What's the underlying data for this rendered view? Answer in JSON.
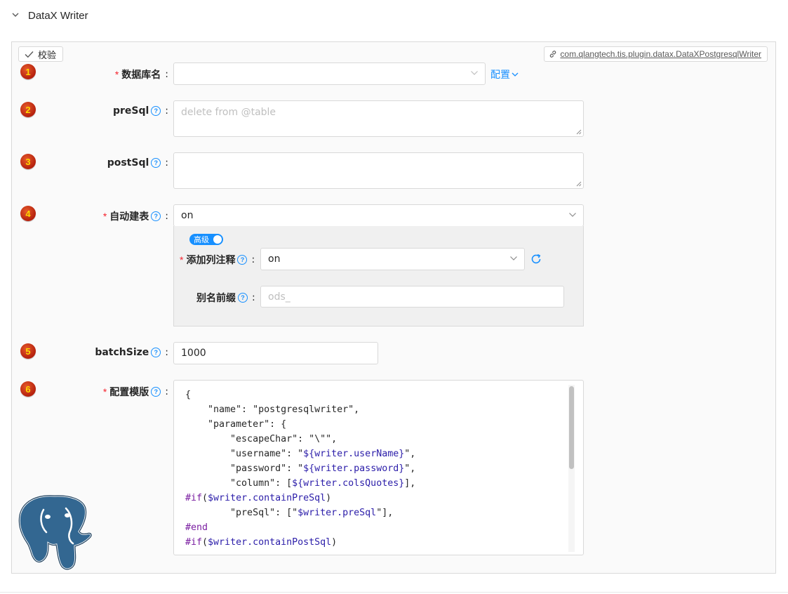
{
  "panel": {
    "title": "DataX Writer"
  },
  "toolbar": {
    "check_label": "校验",
    "plugin_name": "com.qlangtech.tis.plugin.datax.DataXPostgresqlWriter"
  },
  "fields": [
    {
      "index": "1",
      "label": "数据库名",
      "required": true,
      "value": "",
      "link_label": "配置"
    },
    {
      "index": "2",
      "label": "preSql",
      "placeholder": "delete from @table"
    },
    {
      "index": "3",
      "label": "postSql",
      "placeholder": ""
    },
    {
      "index": "4",
      "label": "自动建表",
      "required": true,
      "value": "on"
    },
    {
      "index": "5",
      "label": "batchSize",
      "value": "1000"
    },
    {
      "index": "6",
      "label": "配置模版",
      "required": true
    }
  ],
  "advanced": {
    "toggle_label": "高级",
    "add_comment": {
      "label": "添加列注释",
      "value": "on"
    },
    "alias_prefix": {
      "label": "别名前缀",
      "placeholder": "ods_"
    }
  },
  "colon": ":",
  "required_mark": "*",
  "help_glyph": "?",
  "template_lines": [
    "{",
    "    \"name\": \"postgresqlwriter\",",
    "    \"parameter\": {",
    "        \"escapeChar\": \"\\\"\",",
    "        \"username\": \"${writer.userName}\",",
    "        \"password\": \"${writer.password}\",",
    "        \"column\": [${writer.colsQuotes}],",
    "#if($writer.containPreSql)",
    "        \"preSql\": [\"$writer.preSql\"],",
    "#end",
    "#if($writer.containPostSql)"
  ],
  "colors": {
    "accent": "#1890ff",
    "required": "#f5222d",
    "badge": "#c62b10"
  },
  "icons": {
    "collapse": "chevron-down-icon",
    "check": "check-icon",
    "link": "link-icon",
    "help": "question-circle-icon",
    "refresh": "refresh-icon",
    "logo": "postgresql-elephant-logo"
  }
}
